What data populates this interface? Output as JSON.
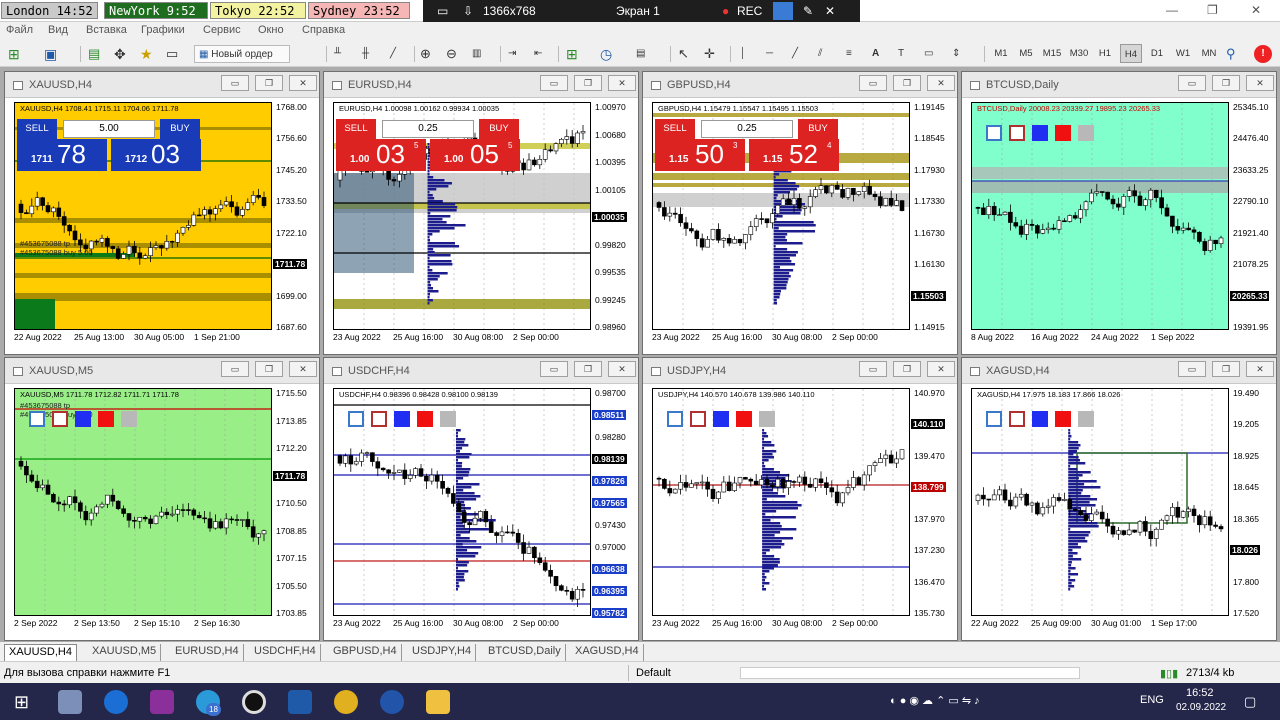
{
  "top": {
    "clocks": [
      {
        "label": "London 14:52",
        "bg": "#c9c9c9"
      },
      {
        "label": "NewYork 9:52",
        "bg": "#1f6d1f",
        "fg": "#ffffff"
      },
      {
        "label": "Tokyo 22:52",
        "bg": "#f2f2a0"
      },
      {
        "label": "Sydney 23:52",
        "bg": "#f6b6b6"
      }
    ],
    "resolution": "1366x768",
    "screen": "Экран 1",
    "rec": "REC"
  },
  "menu": [
    "Файл",
    "Вид",
    "Вставка",
    "Графики",
    "Сервис",
    "Окно",
    "Справка"
  ],
  "toolbar": {
    "new_order": "Новый ордер",
    "timeframes": [
      "M1",
      "M5",
      "M15",
      "M30",
      "H1",
      "H4",
      "D1",
      "W1",
      "MN"
    ],
    "active_tf": "H4"
  },
  "charts": [
    {
      "title": "XAUUSD,H4",
      "caption": "XAUUSD,H4  1708.41 1715.11 1704.06 1711.78",
      "sell": "SELL",
      "buy": "BUY",
      "lot": "5.00",
      "sell_price": {
        "small": "1711",
        "big": "78"
      },
      "buy_price": {
        "small": "1712",
        "big": "03"
      },
      "prices": [
        "1768.00",
        "1756.60",
        "1745.20",
        "1733.50",
        "1722.10",
        "1711.78",
        "1699.00",
        "1687.60"
      ],
      "times": [
        "22 Aug 2022",
        "25 Aug 13:00",
        "30 Aug 05:00",
        "1 Sep 21:00"
      ],
      "order_labels": [
        "#453675088 tp",
        "#453675088 buy 5.00"
      ],
      "bg": "#ffcc00"
    },
    {
      "title": "EURUSD,H4",
      "caption": "EURUSD,H4  1.00098 1.00162 0.99934 1.00035",
      "sell": "SELL",
      "buy": "BUY",
      "lot": "0.25",
      "sell_price": {
        "small": "1.00",
        "big": "03",
        "pip": "5"
      },
      "buy_price": {
        "small": "1.00",
        "big": "05",
        "pip": "5"
      },
      "prices": [
        "1.00970",
        "1.00680",
        "1.00395",
        "1.00105",
        "1.00035",
        "0.99820",
        "0.99535",
        "0.99245",
        "0.98960"
      ],
      "times": [
        "23 Aug 2022",
        "25 Aug 16:00",
        "30 Aug 08:00",
        "2 Sep 00:00"
      ]
    },
    {
      "title": "GBPUSD,H4",
      "caption": "GBPUSD,H4  1.15479 1.15547 1.15495 1.15503",
      "sell": "SELL",
      "buy": "BUY",
      "lot": "0.25",
      "sell_price": {
        "small": "1.15",
        "big": "50",
        "pip": "3"
      },
      "buy_price": {
        "small": "1.15",
        "big": "52",
        "pip": "4"
      },
      "prices": [
        "1.19145",
        "1.18545",
        "1.17930",
        "1.17330",
        "1.16730",
        "1.16130",
        "1.15503",
        "1.14915"
      ],
      "times": [
        "23 Aug 2022",
        "25 Aug 16:00",
        "30 Aug 08:00",
        "2 Sep 00:00"
      ]
    },
    {
      "title": "BTCUSD,Daily",
      "caption": "BTCUSD,Daily  20008.23 20339.27 19895.23 20265.33",
      "prices": [
        "25345.10",
        "24476.40",
        "23633.25",
        "22790.10",
        "21921.40",
        "21078.25",
        "20265.33",
        "19391.95"
      ],
      "times": [
        "8 Aug 2022",
        "16 Aug 2022",
        "24 Aug 2022",
        "1 Sep 2022"
      ],
      "bg": "#80ffcc"
    },
    {
      "title": "XAUUSD,M5",
      "caption": "XAUUSD,M5  1711.78 1712.82 1711.71 1711.78",
      "prices": [
        "1715.50",
        "1713.85",
        "1712.20",
        "1711.78",
        "1710.50",
        "1708.85",
        "1707.15",
        "1705.50",
        "1703.85"
      ],
      "times": [
        "2 Sep 2022",
        "2 Sep 13:50",
        "2 Sep 15:10",
        "2 Sep 16:30"
      ],
      "order_labels": [
        "#453675088 tp",
        "#453675088 buy 5.00"
      ],
      "bg": "#99ee88"
    },
    {
      "title": "USDCHF,H4",
      "caption": "USDCHF,H4  0.98396 0.98428 0.98100 0.98139",
      "prices": [
        "0.98700",
        "0.98511",
        "0.98280",
        "0.98139",
        "0.97826",
        "0.97565",
        "0.97430",
        "0.97000",
        "0.96638",
        "0.96395",
        "0.95782"
      ],
      "times": [
        "23 Aug 2022",
        "25 Aug 16:00",
        "30 Aug 08:00",
        "2 Sep 00:00"
      ]
    },
    {
      "title": "USDJPY,H4",
      "caption": "USDJPY,H4  140.570 140.678 139.986 140.110",
      "prices": [
        "140.970",
        "140.110",
        "139.470",
        "138.799",
        "137.970",
        "137.230",
        "136.470",
        "135.730"
      ],
      "times": [
        "23 Aug 2022",
        "25 Aug 16:00",
        "30 Aug 08:00",
        "2 Sep 00:00"
      ]
    },
    {
      "title": "XAGUSD,H4",
      "caption": "XAGUSD,H4  17.975 18.183 17.866 18.026",
      "prices": [
        "19.490",
        "19.205",
        "18.925",
        "18.645",
        "18.365",
        "18.026",
        "17.800",
        "17.520"
      ],
      "times": [
        "22 Aug 2022",
        "25 Aug 09:00",
        "30 Aug 01:00",
        "1 Sep 17:00"
      ]
    }
  ],
  "tabs": [
    "XAUUSD,H4",
    "XAUUSD,M5",
    "EURUSD,H4",
    "USDCHF,H4",
    "GBPUSD,H4",
    "USDJPY,H4",
    "BTCUSD,Daily",
    "XAGUSD,H4"
  ],
  "active_tab": "XAUUSD,H4",
  "status": {
    "help": "Для вызова справки нажмите F1",
    "profile": "Default",
    "traffic": "2713/4 kb"
  },
  "taskbar": {
    "lang": "ENG",
    "time": "16:52",
    "date": "02.09.2022",
    "badge": "18"
  },
  "colors": {
    "up_candle": "#ffffff",
    "down_candle": "#000000",
    "profile": "#1c1c8c",
    "sell_blue": "#1a3bb8",
    "sell_red": "#d22222"
  }
}
